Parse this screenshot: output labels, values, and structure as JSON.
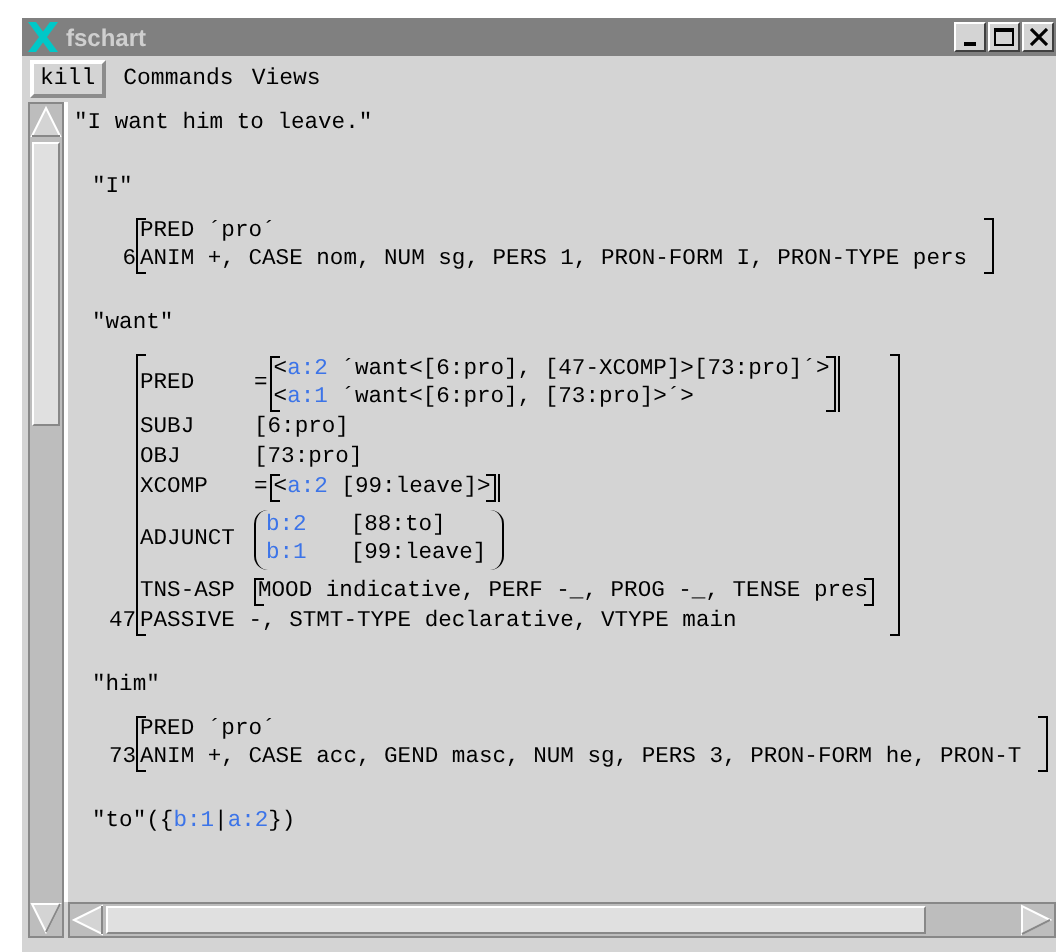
{
  "window": {
    "title": "fschart"
  },
  "menu": {
    "button": "kill",
    "items": [
      "Commands",
      "Views"
    ]
  },
  "sentence": "\"I want him to leave.\"",
  "blocks": [
    {
      "label": "\"I\"",
      "index": "6",
      "rows": [
        {
          "kind": "line",
          "text": "PRED ´pro´"
        },
        {
          "kind": "line",
          "text": "ANIM +, CASE nom, NUM sg, PERS 1, PRON-FORM I, PRON-TYPE pers"
        }
      ]
    },
    {
      "label": "\"want\"",
      "index": "47",
      "rows": [
        {
          "kind": "attr",
          "name": "PRED",
          "value": {
            "kind": "disjunction",
            "prefix": "=",
            "options": [
              {
                "open": "<",
                "context": "a:2",
                "text": "´want<[6:pro], [47-XCOMP]>[73:pro]´>"
              },
              {
                "open": "<",
                "context": "a:1",
                "text": "´want<[6:pro], [73:pro]>´>"
              }
            ]
          }
        },
        {
          "kind": "attr",
          "name": "SUBJ",
          "value": {
            "kind": "text",
            "text": "[6:pro]"
          }
        },
        {
          "kind": "attr",
          "name": "OBJ",
          "value": {
            "kind": "text",
            "text": "[73:pro]"
          }
        },
        {
          "kind": "attr",
          "name": "XCOMP",
          "value": {
            "kind": "disjunction",
            "prefix": "=",
            "options": [
              {
                "open": "<",
                "context": "a:2",
                "text": "[99:leave]>"
              }
            ]
          }
        },
        {
          "kind": "attr",
          "name": "ADJUNCT",
          "value": {
            "kind": "set",
            "options": [
              {
                "context": "b:2",
                "text": "[88:to]"
              },
              {
                "context": "b:1",
                "text": "[99:leave]"
              }
            ]
          }
        },
        {
          "kind": "attr",
          "name": "TNS-ASP",
          "value": {
            "kind": "fs",
            "text": "MOOD indicative, PERF -_, PROG -_, TENSE pres"
          }
        },
        {
          "kind": "line",
          "text": "PASSIVE -, STMT-TYPE declarative, VTYPE main"
        }
      ]
    },
    {
      "label": "\"him\"",
      "index": "73",
      "rows": [
        {
          "kind": "line",
          "text": "PRED ´pro´"
        },
        {
          "kind": "line",
          "text": "ANIM +, CASE acc, GEND masc, NUM sg, PERS 3, PRON-FORM he, PRON-T"
        }
      ]
    },
    {
      "label": "\"to\"",
      "label_parts": [
        {
          "kind": "punct",
          "text": "({"
        },
        {
          "kind": "context",
          "text": "b:1"
        },
        {
          "kind": "punct",
          "text": "|"
        },
        {
          "kind": "context",
          "text": "a:2"
        },
        {
          "kind": "punct",
          "text": "})"
        }
      ]
    }
  ]
}
